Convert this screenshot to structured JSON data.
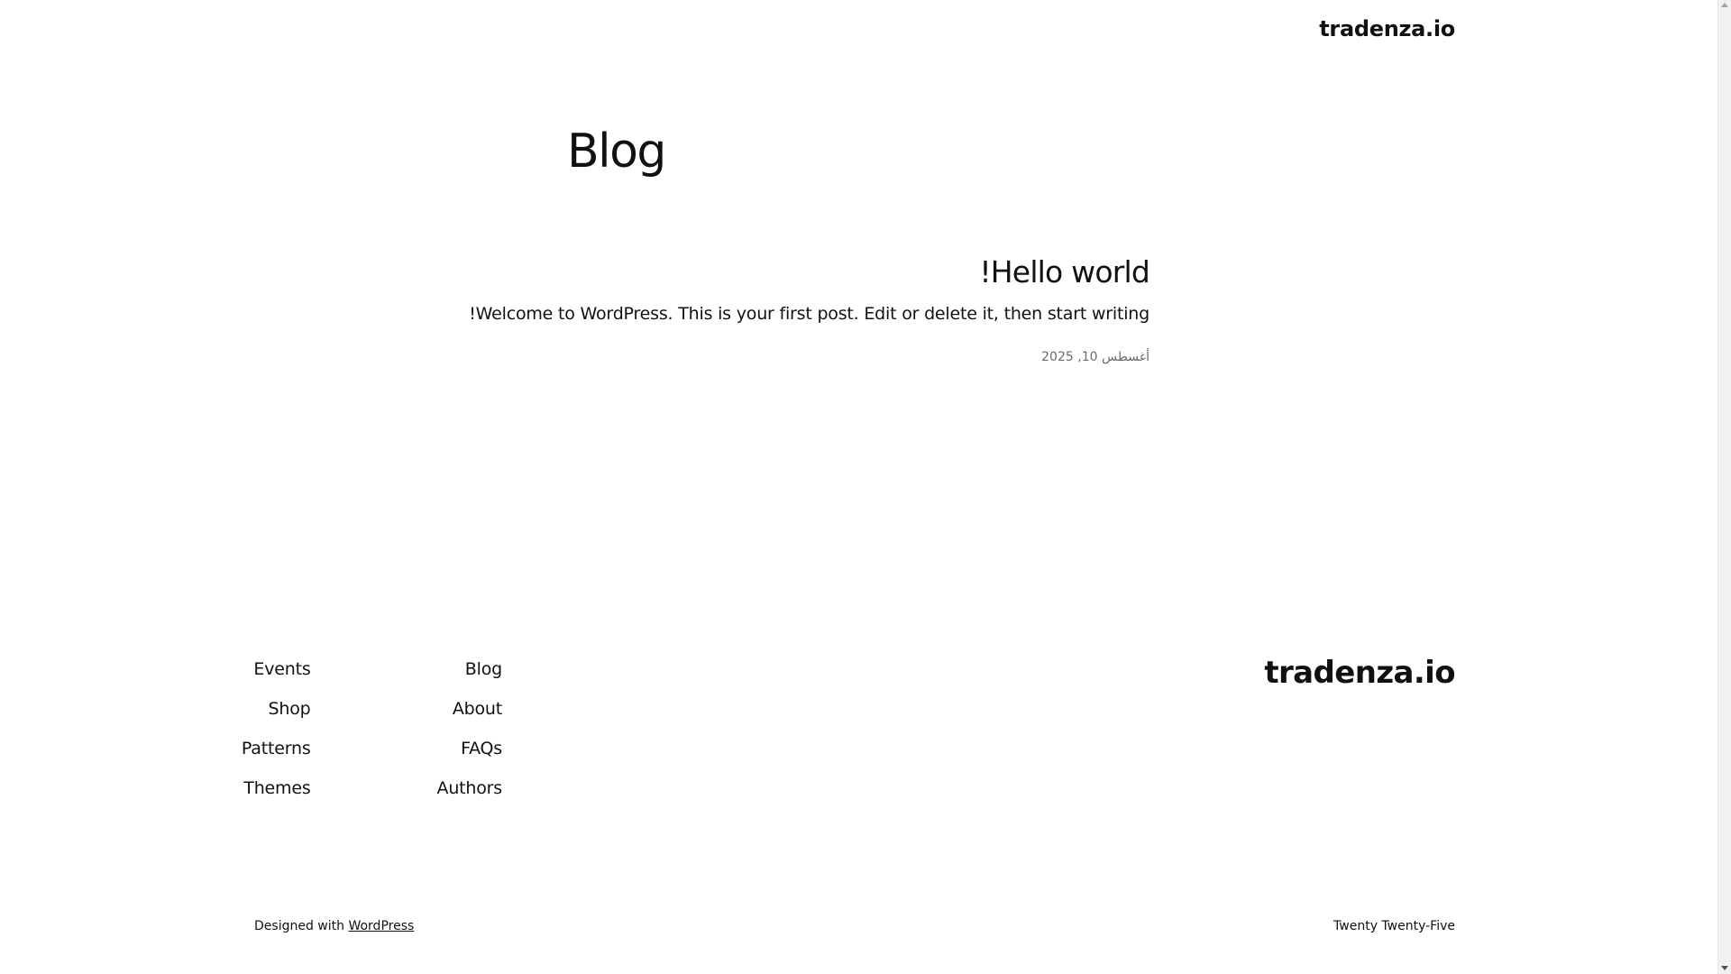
{
  "header": {
    "site_title": "tradenza.io"
  },
  "main": {
    "page_title": "Blog",
    "posts": [
      {
        "title": "Hello world!",
        "excerpt": "Welcome to WordPress. This is your first post. Edit or delete it, then start writing!",
        "date": "أغسطس 10, 2025"
      }
    ]
  },
  "footer": {
    "site_title": "tradenza.io",
    "nav_columns": [
      [
        "Blog",
        "About",
        "FAQs",
        "Authors"
      ],
      [
        "Events",
        "Shop",
        "Patterns",
        "Themes"
      ]
    ],
    "credit_prefix": "Designed with ",
    "credit_link": "WordPress",
    "theme_name": "Twenty Twenty-Five"
  },
  "colors": {
    "text": "#111111",
    "muted": "#6b6b6b",
    "background": "#ffffff"
  }
}
